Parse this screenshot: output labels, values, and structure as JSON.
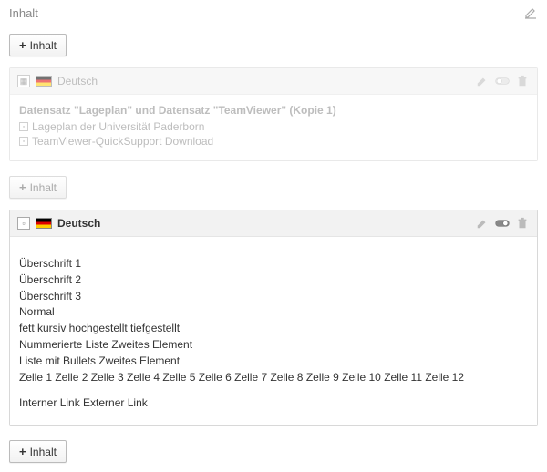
{
  "header": {
    "title": "Inhalt"
  },
  "buttons": {
    "add_top": "Inhalt",
    "add_mid": "Inhalt",
    "add_bottom": "Inhalt"
  },
  "card1": {
    "lang": "Deutsch",
    "title": "Datensatz \"Lageplan\" und Datensatz \"TeamViewer\" (Kopie 1)",
    "items": [
      "Lageplan der Universität Paderborn",
      "TeamViewer-QuickSupport Download"
    ]
  },
  "card2": {
    "lang": "Deutsch",
    "lines": {
      "h1": "Überschrift 1",
      "h2": "Überschrift 2",
      "h3": "Überschrift 3",
      "normal": "Normal",
      "styles": "fett   kursiv   hochgestellt   tiefgestellt",
      "numlist": "Nummerierte Liste Zweites Element",
      "bulletlist": "Liste mit Bullets Zweites Element",
      "cells": "Zelle 1 Zelle 2 Zelle 3 Zelle 4 Zelle 5 Zelle 6 Zelle 7 Zelle 8 Zelle 9 Zelle 10 Zelle 11 Zelle 12",
      "links": "Interner Link   Externer Link"
    }
  }
}
